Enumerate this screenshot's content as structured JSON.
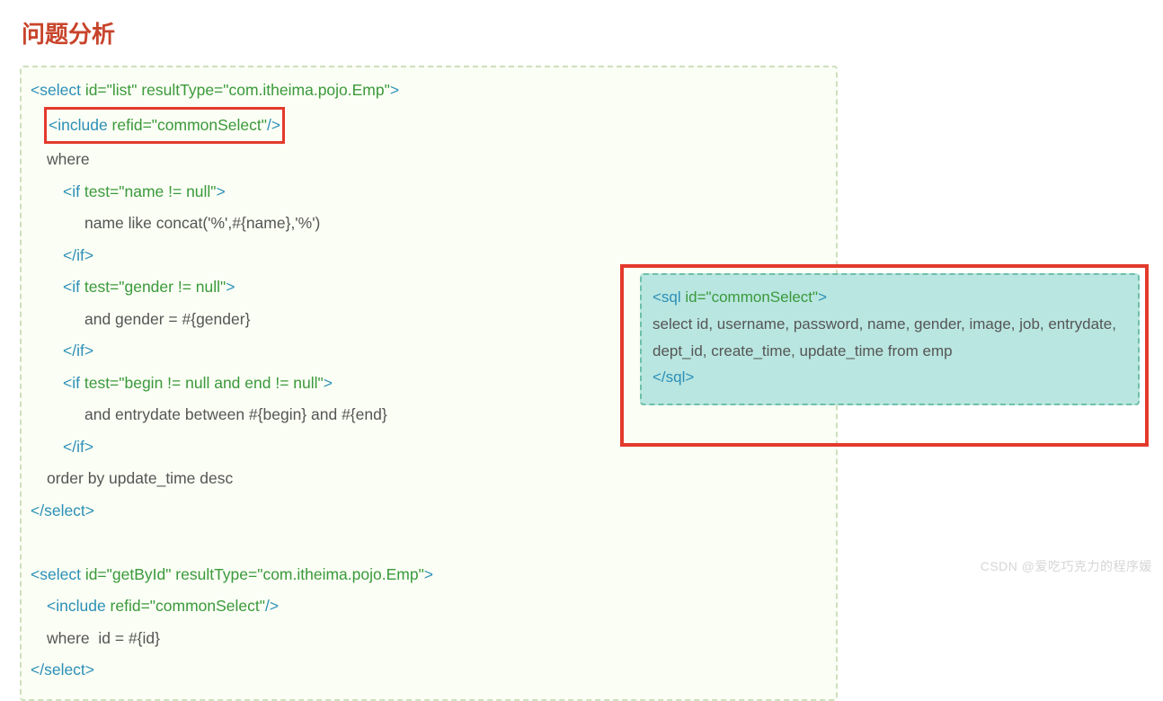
{
  "title": "问题分析",
  "left": {
    "l1a": "<select ",
    "l1b": "id=\"list\" resultType=\"com.itheima.pojo.Emp\"",
    "l1c": ">",
    "l2a": "<include ",
    "l2b": "refid=\"commonSelect\"",
    "l2c": "/>",
    "l3": "where",
    "l4a": "<if ",
    "l4b": "test=\"name != null\"",
    "l4c": ">",
    "l5": "name like concat('%',#{name},'%')",
    "l6": "</if>",
    "l7a": "<if ",
    "l7b": "test=\"gender != null\"",
    "l7c": ">",
    "l8": "and gender = #{gender}",
    "l9": "</if>",
    "l10a": "<if ",
    "l10b": "test=\"begin != null and end != null\"",
    "l10c": ">",
    "l11": "and entrydate between #{begin} and #{end}",
    "l12": "</if>",
    "l13": "order by update_time desc",
    "l14": "</select>",
    "l16a": "<select ",
    "l16b": "id=\"getById\" resultType=\"com.itheima.pojo.Emp\"",
    "l16c": ">",
    "l17a": "<include ",
    "l17b": "refid=\"commonSelect\"",
    "l17c": "/>",
    "l18": "where  id = #{id}",
    "l19": "</select>"
  },
  "right": {
    "r1a": "<sql ",
    "r1b": "id=\"commonSelect\"",
    "r1c": ">",
    "r2": " select id, username, password, name, gender, image, job, entrydate, dept_id, create_time, update_time from emp",
    "r3": "</sql>"
  },
  "watermark": "CSDN @爱吃巧克力的程序媛"
}
